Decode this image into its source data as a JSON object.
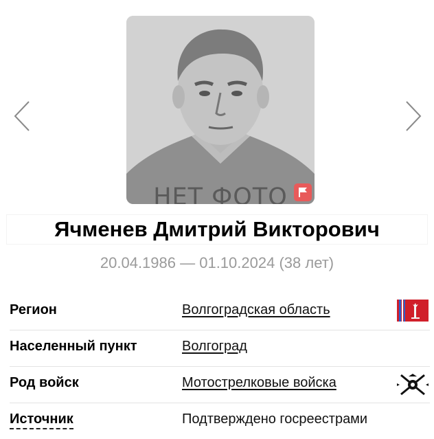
{
  "photo": {
    "no_photo_label": "НЕТ ФОТО",
    "flag_color": "#e85a5a"
  },
  "person": {
    "full_name": "Ячменев Дмитрий Викторович",
    "dates": "20.04.1986 — 01.10.2024 (38 лет)"
  },
  "details": {
    "region": {
      "label": "Регион",
      "value": "Волгоградская область",
      "icon": "region-emblem-icon"
    },
    "settlement": {
      "label": "Населенный пункт",
      "value": "Волгоград"
    },
    "branch": {
      "label": "Род войск",
      "value": "Мотострелковые войска",
      "icon": "motor-rifle-emblem-icon"
    },
    "source": {
      "label": "Источник",
      "value": "Подтверждено госреестрами"
    }
  },
  "navigation": {
    "prev_icon": "chevron-left-icon",
    "next_icon": "chevron-right-icon"
  }
}
